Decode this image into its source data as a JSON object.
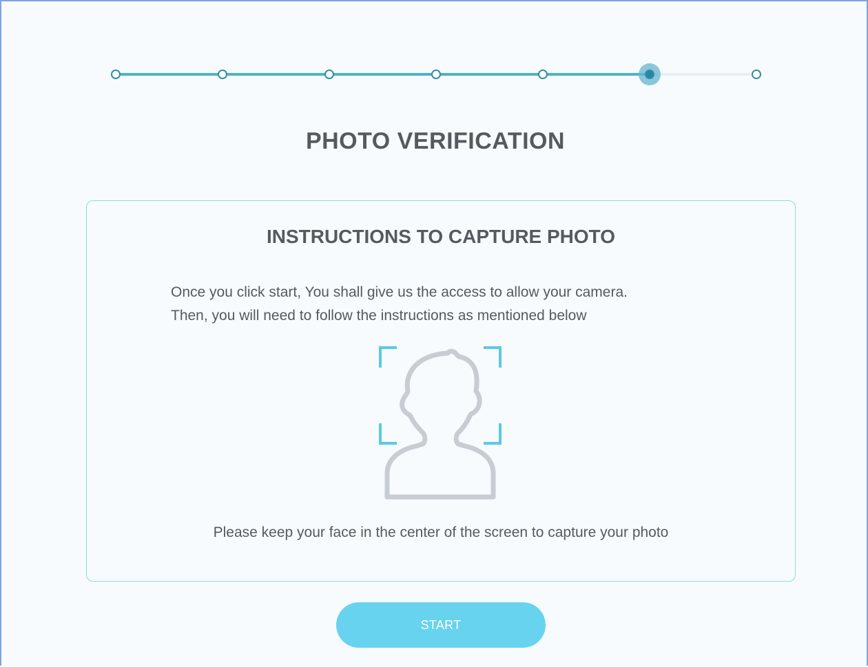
{
  "stepper": {
    "total_steps": 7,
    "current_step": 6,
    "progress_fraction": 0.833
  },
  "page": {
    "title": "PHOTO VERIFICATION"
  },
  "card": {
    "title": "INSTRUCTIONS TO CAPTURE PHOTO",
    "instruction_line_1": "Once you click start, You shall give us the access to allow your camera.",
    "instruction_line_2": "Then, you will need to follow the instructions as mentioned below",
    "illustration_icon": "face-frame-icon",
    "hint": "Please keep your face in the center of the screen to capture your photo"
  },
  "actions": {
    "start_label": "START"
  },
  "colors": {
    "accent": "#4db3c9",
    "step_border": "#2f8fa8",
    "button": "#67d3ef",
    "card_border": "#8fd8ea",
    "text": "#555a60",
    "illustration": "#c8ccd3"
  }
}
